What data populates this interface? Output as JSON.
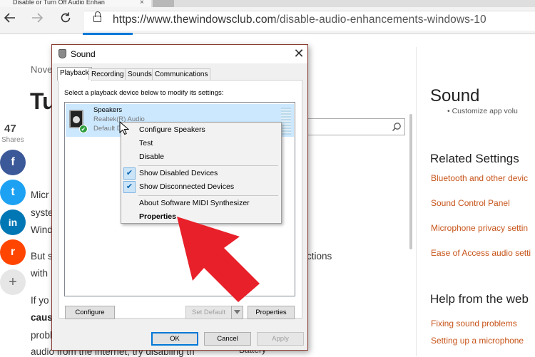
{
  "browser": {
    "tab_title": "Disable or Turn Off Audio Enhan",
    "tab_close": "×",
    "url_host": "https://www.thewindowsclub.com",
    "url_path": "/disable-audio-enhancements-windows-10",
    "back_icon": "arrow-left-icon",
    "forward_icon": "arrow-right-icon",
    "refresh_icon": "refresh-icon",
    "lock_icon": "lock-icon"
  },
  "article": {
    "date_fragment": "Nove",
    "title_fragment": "Tu",
    "shares_count": "47",
    "shares_label": "Shares",
    "para_lines": [
      "Micr",
      "syste",
      "Wind"
    ],
    "para2_lines": [
      "But s",
      "with"
    ],
    "para3_line": "If yo",
    "bold_fragment": "caus",
    "prob_fragment": "probl",
    "last_line": "audio from the internet, try disabling th",
    "ctions_fragment": "ctions",
    "battery_fragment": "Battery",
    "social": [
      {
        "name": "facebook",
        "glyph": "f",
        "color": "#3b5998"
      },
      {
        "name": "twitter",
        "glyph": "t",
        "color": "#1da1f2"
      },
      {
        "name": "linkedin",
        "glyph": "in",
        "color": "#0077b5"
      },
      {
        "name": "reddit",
        "glyph": "r",
        "color": "#ff4500"
      },
      {
        "name": "more",
        "glyph": "+",
        "color": "#e6e6e6"
      }
    ]
  },
  "settings": {
    "title": "Sound",
    "customize_fragment": "Customize app volu",
    "related_heading": "Related Settings",
    "related_links": [
      "Bluetooth and other devic",
      "Sound Control Panel",
      "Microphone privacy settin",
      "Ease of Access audio setti"
    ],
    "help_heading": "Help from the web",
    "help_links": [
      "Fixing sound problems",
      "Setting up a microphone"
    ]
  },
  "dialog": {
    "title": "Sound",
    "close": "✕",
    "tabs": [
      "Playback",
      "Recording",
      "Sounds",
      "Communications"
    ],
    "instruction": "Select a playback device below to modify its settings:",
    "device": {
      "name": "Speakers",
      "driver": "Realtek(R) Audio",
      "status": "Default De"
    },
    "buttons": {
      "configure": "Configure",
      "set_default": "Set Default",
      "properties": "Properties",
      "ok": "OK",
      "cancel": "Cancel",
      "apply": "Apply"
    }
  },
  "context_menu": {
    "items": [
      {
        "label": "Configure Speakers",
        "checked": false,
        "bold": false
      },
      {
        "label": "Test",
        "checked": false,
        "bold": false
      },
      {
        "label": "Disable",
        "checked": false,
        "bold": false
      },
      {
        "label": "Show Disabled Devices",
        "checked": true,
        "bold": false
      },
      {
        "label": "Show Disconnected Devices",
        "checked": true,
        "bold": false
      },
      {
        "label": "About Software MIDI Synthesizer",
        "checked": false,
        "bold": false
      },
      {
        "label": "Properties",
        "checked": false,
        "bold": true
      }
    ],
    "check_glyph": "✔"
  },
  "colors": {
    "accent_blue": "#0078d7",
    "link_orange": "#c7541a",
    "annotation_red": "#e8202a",
    "dialog_border": "#8a3a2f"
  }
}
